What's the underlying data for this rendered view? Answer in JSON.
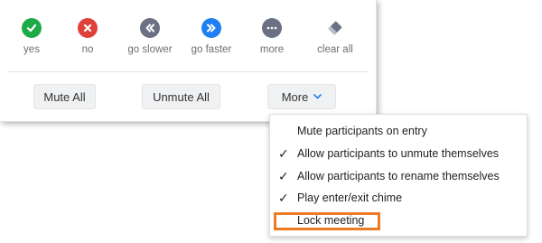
{
  "reactions": [
    {
      "label": "yes",
      "icon": "check-icon",
      "color": "#1faa48"
    },
    {
      "label": "no",
      "icon": "close-icon",
      "color": "#e0423b"
    },
    {
      "label": "go slower",
      "icon": "rewind-icon",
      "color": "#6b7182"
    },
    {
      "label": "go faster",
      "icon": "fast-forward-icon",
      "color": "#1f7ff2"
    },
    {
      "label": "more",
      "icon": "more-icon",
      "color": "#6b7182"
    },
    {
      "label": "clear all",
      "icon": "eraser-icon",
      "color": "#6b7182"
    }
  ],
  "buttons": {
    "mute_all": "Mute All",
    "unmute_all": "Unmute All",
    "more": "More"
  },
  "menu": {
    "items": [
      {
        "label": "Mute participants on entry",
        "checked": false
      },
      {
        "label": "Allow participants to unmute themselves",
        "checked": true
      },
      {
        "label": "Allow participants to rename themselves",
        "checked": true
      },
      {
        "label": "Play enter/exit chime",
        "checked": true
      },
      {
        "label": "Lock meeting",
        "checked": false
      }
    ],
    "check_glyph": "✓"
  },
  "colors": {
    "accent": "#1f7ff2",
    "highlight": "#ee7a23"
  }
}
